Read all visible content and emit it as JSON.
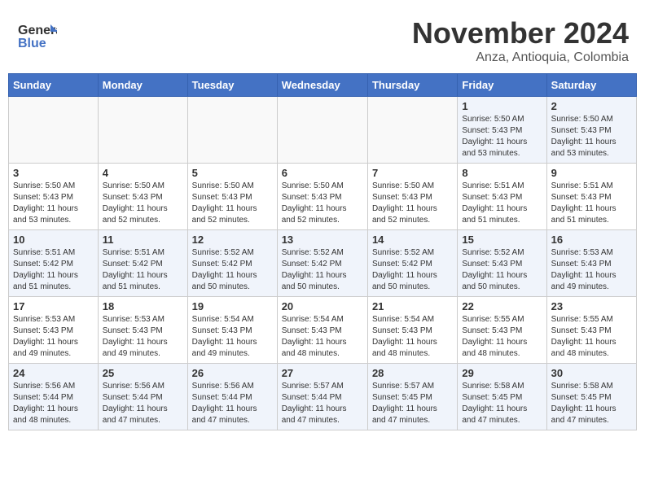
{
  "header": {
    "logo_line1": "General",
    "logo_line2": "Blue",
    "month": "November 2024",
    "location": "Anza, Antioquia, Colombia"
  },
  "days_of_week": [
    "Sunday",
    "Monday",
    "Tuesday",
    "Wednesday",
    "Thursday",
    "Friday",
    "Saturday"
  ],
  "weeks": [
    [
      {
        "day": "",
        "info": ""
      },
      {
        "day": "",
        "info": ""
      },
      {
        "day": "",
        "info": ""
      },
      {
        "day": "",
        "info": ""
      },
      {
        "day": "",
        "info": ""
      },
      {
        "day": "1",
        "info": "Sunrise: 5:50 AM\nSunset: 5:43 PM\nDaylight: 11 hours\nand 53 minutes."
      },
      {
        "day": "2",
        "info": "Sunrise: 5:50 AM\nSunset: 5:43 PM\nDaylight: 11 hours\nand 53 minutes."
      }
    ],
    [
      {
        "day": "3",
        "info": "Sunrise: 5:50 AM\nSunset: 5:43 PM\nDaylight: 11 hours\nand 53 minutes."
      },
      {
        "day": "4",
        "info": "Sunrise: 5:50 AM\nSunset: 5:43 PM\nDaylight: 11 hours\nand 52 minutes."
      },
      {
        "day": "5",
        "info": "Sunrise: 5:50 AM\nSunset: 5:43 PM\nDaylight: 11 hours\nand 52 minutes."
      },
      {
        "day": "6",
        "info": "Sunrise: 5:50 AM\nSunset: 5:43 PM\nDaylight: 11 hours\nand 52 minutes."
      },
      {
        "day": "7",
        "info": "Sunrise: 5:50 AM\nSunset: 5:43 PM\nDaylight: 11 hours\nand 52 minutes."
      },
      {
        "day": "8",
        "info": "Sunrise: 5:51 AM\nSunset: 5:43 PM\nDaylight: 11 hours\nand 51 minutes."
      },
      {
        "day": "9",
        "info": "Sunrise: 5:51 AM\nSunset: 5:43 PM\nDaylight: 11 hours\nand 51 minutes."
      }
    ],
    [
      {
        "day": "10",
        "info": "Sunrise: 5:51 AM\nSunset: 5:42 PM\nDaylight: 11 hours\nand 51 minutes."
      },
      {
        "day": "11",
        "info": "Sunrise: 5:51 AM\nSunset: 5:42 PM\nDaylight: 11 hours\nand 51 minutes."
      },
      {
        "day": "12",
        "info": "Sunrise: 5:52 AM\nSunset: 5:42 PM\nDaylight: 11 hours\nand 50 minutes."
      },
      {
        "day": "13",
        "info": "Sunrise: 5:52 AM\nSunset: 5:42 PM\nDaylight: 11 hours\nand 50 minutes."
      },
      {
        "day": "14",
        "info": "Sunrise: 5:52 AM\nSunset: 5:42 PM\nDaylight: 11 hours\nand 50 minutes."
      },
      {
        "day": "15",
        "info": "Sunrise: 5:52 AM\nSunset: 5:43 PM\nDaylight: 11 hours\nand 50 minutes."
      },
      {
        "day": "16",
        "info": "Sunrise: 5:53 AM\nSunset: 5:43 PM\nDaylight: 11 hours\nand 49 minutes."
      }
    ],
    [
      {
        "day": "17",
        "info": "Sunrise: 5:53 AM\nSunset: 5:43 PM\nDaylight: 11 hours\nand 49 minutes."
      },
      {
        "day": "18",
        "info": "Sunrise: 5:53 AM\nSunset: 5:43 PM\nDaylight: 11 hours\nand 49 minutes."
      },
      {
        "day": "19",
        "info": "Sunrise: 5:54 AM\nSunset: 5:43 PM\nDaylight: 11 hours\nand 49 minutes."
      },
      {
        "day": "20",
        "info": "Sunrise: 5:54 AM\nSunset: 5:43 PM\nDaylight: 11 hours\nand 48 minutes."
      },
      {
        "day": "21",
        "info": "Sunrise: 5:54 AM\nSunset: 5:43 PM\nDaylight: 11 hours\nand 48 minutes."
      },
      {
        "day": "22",
        "info": "Sunrise: 5:55 AM\nSunset: 5:43 PM\nDaylight: 11 hours\nand 48 minutes."
      },
      {
        "day": "23",
        "info": "Sunrise: 5:55 AM\nSunset: 5:43 PM\nDaylight: 11 hours\nand 48 minutes."
      }
    ],
    [
      {
        "day": "24",
        "info": "Sunrise: 5:56 AM\nSunset: 5:44 PM\nDaylight: 11 hours\nand 48 minutes."
      },
      {
        "day": "25",
        "info": "Sunrise: 5:56 AM\nSunset: 5:44 PM\nDaylight: 11 hours\nand 47 minutes."
      },
      {
        "day": "26",
        "info": "Sunrise: 5:56 AM\nSunset: 5:44 PM\nDaylight: 11 hours\nand 47 minutes."
      },
      {
        "day": "27",
        "info": "Sunrise: 5:57 AM\nSunset: 5:44 PM\nDaylight: 11 hours\nand 47 minutes."
      },
      {
        "day": "28",
        "info": "Sunrise: 5:57 AM\nSunset: 5:45 PM\nDaylight: 11 hours\nand 47 minutes."
      },
      {
        "day": "29",
        "info": "Sunrise: 5:58 AM\nSunset: 5:45 PM\nDaylight: 11 hours\nand 47 minutes."
      },
      {
        "day": "30",
        "info": "Sunrise: 5:58 AM\nSunset: 5:45 PM\nDaylight: 11 hours\nand 47 minutes."
      }
    ]
  ]
}
